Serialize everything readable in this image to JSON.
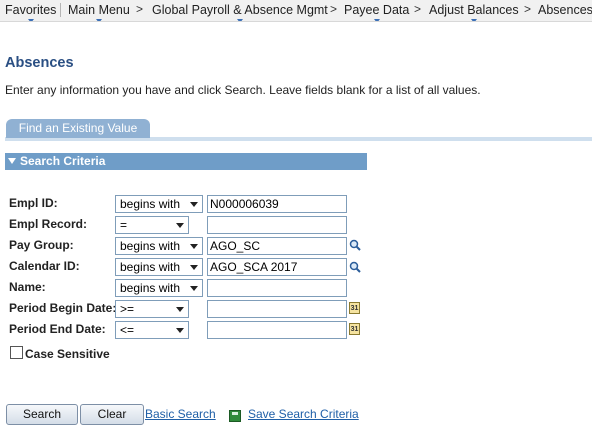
{
  "nav": {
    "items": [
      {
        "label": "Favorites"
      },
      {
        "label": "Main Menu"
      },
      {
        "label": "Global Payroll & Absence Mgmt"
      },
      {
        "label": "Payee Data"
      },
      {
        "label": "Adjust Balances"
      },
      {
        "label": "Absences"
      }
    ],
    "separator": ">"
  },
  "page": {
    "title": "Absences",
    "instructions": "Enter any information you have and click Search. Leave fields blank for a list of all values.",
    "tab_label": "Find an Existing Value",
    "section_label": "Search Criteria"
  },
  "fields": [
    {
      "label": "Empl ID:",
      "operator": "begins with",
      "value": "N000006039"
    },
    {
      "label": "Empl Record:",
      "operator": "=",
      "value": ""
    },
    {
      "label": "Pay Group:",
      "operator": "begins with",
      "value": "AGO_SC"
    },
    {
      "label": "Calendar ID:",
      "operator": "begins with",
      "value": "AGO_SCA 2017"
    },
    {
      "label": "Name:",
      "operator": "begins with",
      "value": ""
    },
    {
      "label": "Period Begin Date:",
      "operator": ">=",
      "value": ""
    },
    {
      "label": "Period End Date:",
      "operator": "<=",
      "value": ""
    }
  ],
  "calendar_icon_text": "31",
  "case_sensitive": {
    "label": "Case Sensitive",
    "checked": false
  },
  "buttons": {
    "search": "Search",
    "clear": "Clear"
  },
  "links": {
    "basic_search": "Basic Search",
    "save_search": "Save Search Criteria"
  },
  "colors": {
    "accent": "#6f9dc8",
    "title": "#2a4f83",
    "link": "#1f5fa7"
  }
}
